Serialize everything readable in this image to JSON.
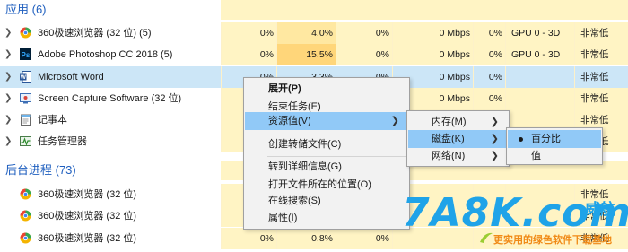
{
  "groups": {
    "apps": {
      "label": "应用 (6)"
    },
    "background": {
      "label": "后台进程 (73)"
    }
  },
  "rows": [
    {
      "name": "360极速浏览器 (32 位) (5)",
      "icon": "360-browser-icon",
      "cpu": "0%",
      "mem": "4.0%",
      "disk": "0%",
      "net": "0 Mbps",
      "gpu": "0%",
      "engine": "GPU 0 - 3D",
      "power": "非常低"
    },
    {
      "name": "Adobe Photoshop CC 2018 (5)",
      "icon": "photoshop-icon",
      "cpu": "0%",
      "mem": "15.5%",
      "disk": "0%",
      "net": "0 Mbps",
      "gpu": "0%",
      "engine": "GPU 0 - 3D",
      "power": "非常低"
    },
    {
      "name": "Microsoft Word",
      "icon": "word-icon",
      "cpu": "0%",
      "mem": "3.3%",
      "disk": "0%",
      "net": "0 Mbps",
      "gpu": "0%",
      "engine": "",
      "power": "非常低"
    },
    {
      "name": "Screen Capture Software (32 位)",
      "icon": "screen-capture-icon",
      "cpu": "",
      "mem": "",
      "disk": "",
      "net": "0 Mbps",
      "gpu": "0%",
      "engine": "",
      "power": "非常低"
    },
    {
      "name": "记事本",
      "icon": "notepad-icon",
      "cpu": "",
      "mem": "",
      "disk": "",
      "net": "",
      "gpu": "",
      "engine": "",
      "power": "非常低"
    },
    {
      "name": "任务管理器",
      "icon": "task-manager-icon",
      "cpu": "",
      "mem": "",
      "disk": "",
      "net": "",
      "gpu": "",
      "engine": "",
      "power": "非常低"
    },
    {
      "name": "360极速浏览器 (32 位)",
      "icon": "360-browser-icon",
      "cpu": "",
      "mem": "",
      "disk": "",
      "net": "",
      "gpu": "",
      "engine": "",
      "power": "非常低"
    },
    {
      "name": "360极速浏览器 (32 位)",
      "icon": "360-browser-icon",
      "cpu": "",
      "mem": "",
      "disk": "",
      "net": "",
      "gpu": "",
      "engine": "",
      "power": "非常低"
    },
    {
      "name": "360极速浏览器 (32 位)",
      "icon": "360-browser-icon",
      "cpu": "0%",
      "mem": "0.8%",
      "disk": "0%",
      "net": "",
      "gpu": "",
      "engine": "",
      "power": "非常低"
    }
  ],
  "context_menu": {
    "items": [
      {
        "label": "展开(P)"
      },
      {
        "label": "结束任务(E)"
      },
      {
        "label": "资源值(V)"
      },
      {
        "label": "创建转储文件(C)"
      },
      {
        "label": "转到详细信息(G)"
      },
      {
        "label": "打开文件所在的位置(O)"
      },
      {
        "label": "在线搜索(S)"
      },
      {
        "label": "属性(I)"
      }
    ]
  },
  "submenu_resource": {
    "items": [
      {
        "label": "内存(M)"
      },
      {
        "label": "磁盘(K)"
      },
      {
        "label": "网络(N)"
      }
    ]
  },
  "submenu_disk": {
    "items": [
      {
        "label": "百分比"
      },
      {
        "label": "值"
      }
    ]
  },
  "watermark": {
    "main": "7A8K.com",
    "cn": "威航",
    "sub": "更实用的绿色软件下载基地"
  },
  "colors": {
    "heat_low": "#fff4c4",
    "heat_mid": "#ffe8a1",
    "heat_high": "#ffd67a",
    "selected_row": "#cce6f7",
    "menu_highlight": "#91c9f7",
    "group_label": "#1f5fbf",
    "watermark_blue": "#1fa3e8",
    "watermark_orange": "#f08a16"
  }
}
